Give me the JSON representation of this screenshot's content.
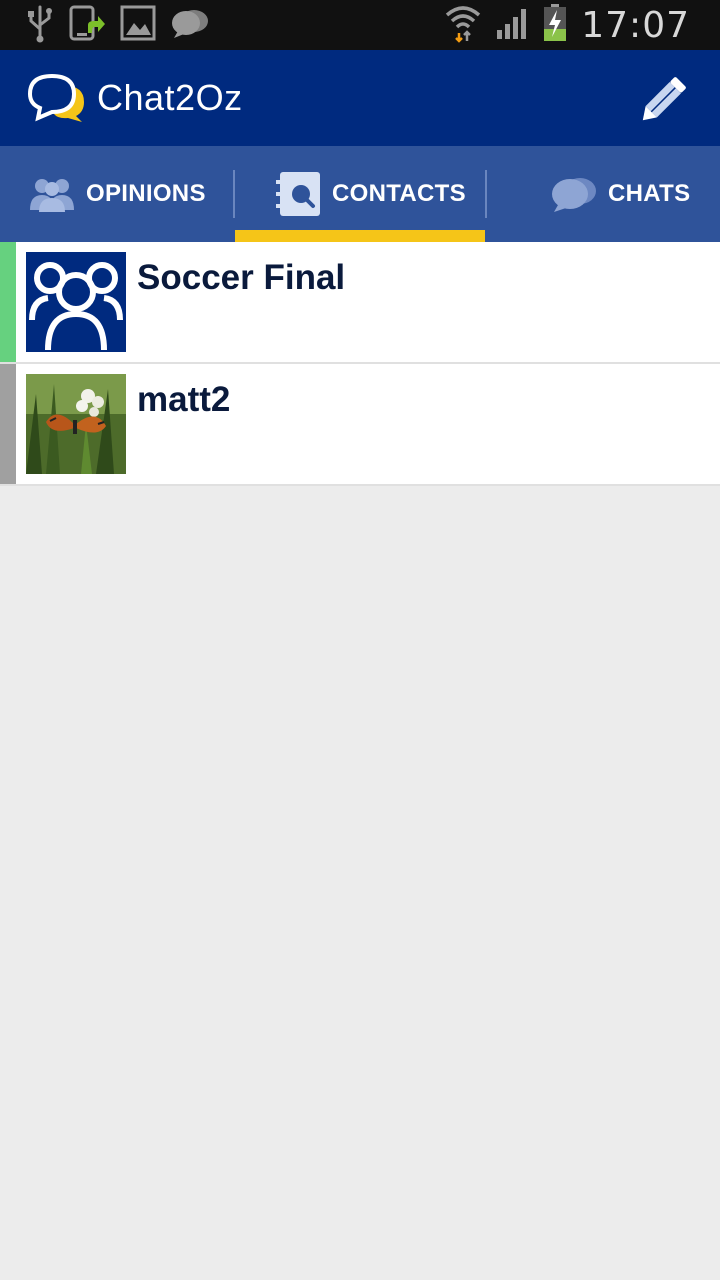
{
  "status_bar": {
    "time": "17:07",
    "left_icons": [
      "usb-icon",
      "screenshot-upload-icon",
      "gallery-icon",
      "chat-notification-icon"
    ],
    "right_icons": [
      "wifi-icon",
      "signal-icon",
      "battery-charging-icon"
    ]
  },
  "app_bar": {
    "title": "Chat2Oz",
    "logo_icon": "chat-bubbles-logo-icon",
    "compose_icon": "pencil-icon"
  },
  "tabs": [
    {
      "label": "OPINIONS",
      "icon": "people-icon",
      "selected": false
    },
    {
      "label": "CONTACTS",
      "icon": "contacts-book-icon",
      "selected": true
    },
    {
      "label": "CHATS",
      "icon": "chat-bubbles-icon",
      "selected": false
    }
  ],
  "contacts": [
    {
      "name": "Soccer Final",
      "avatar": "group-icon",
      "status_color": "#66d17f"
    },
    {
      "name": "matt2",
      "avatar": "butterfly-photo",
      "status_color": "#a0a0a0"
    }
  ],
  "colors": {
    "app_bar": "#002a7f",
    "tab_bar": "#2f539a",
    "tab_indicator": "#f5c518",
    "background": "#ececec"
  }
}
